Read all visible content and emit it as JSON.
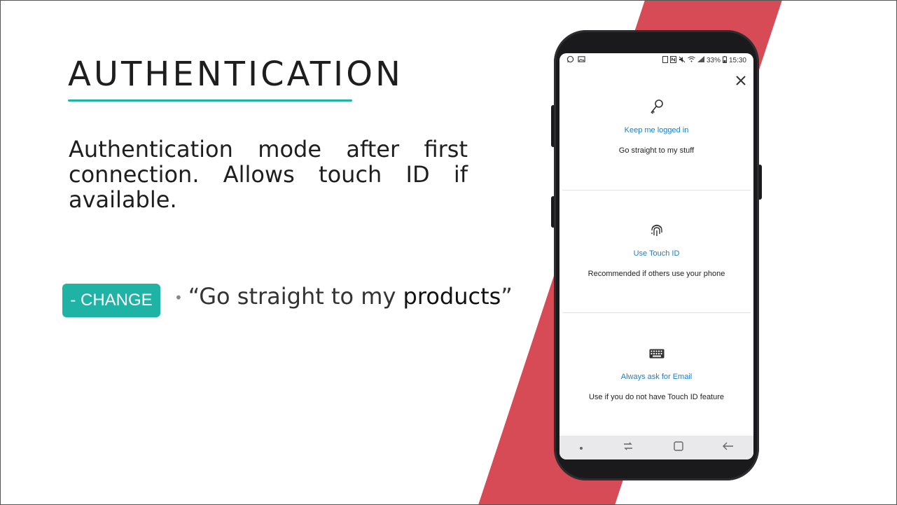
{
  "slide": {
    "title": "AUTHENTICATION",
    "description": "Authentication mode after first connection. Allows touch ID if available.",
    "change_label": "- CHANGE",
    "bullet_prefix": "“Go straight to my ",
    "bullet_bold": "products",
    "bullet_suffix": "”"
  },
  "colors": {
    "accent": "#1fb3a6",
    "stripe": "#d64b55",
    "link": "#1a7ec8"
  },
  "phone": {
    "status": {
      "left_icons": [
        "whatsapp-icon",
        "image-icon"
      ],
      "battery": "33%",
      "time": "15:30"
    },
    "close_icon": "close-icon",
    "options": [
      {
        "icon": "key-icon",
        "title": "Keep me logged in",
        "subtitle": "Go straight to my stuff"
      },
      {
        "icon": "fingerprint-icon",
        "title": "Use Touch ID",
        "subtitle": "Recommended if others use your phone"
      },
      {
        "icon": "keyboard-icon",
        "title": "Always ask for Email",
        "subtitle": "Use if you do not have Touch ID feature"
      }
    ],
    "nav": [
      "dot-icon",
      "recent-apps-icon",
      "home-icon",
      "back-icon"
    ]
  }
}
